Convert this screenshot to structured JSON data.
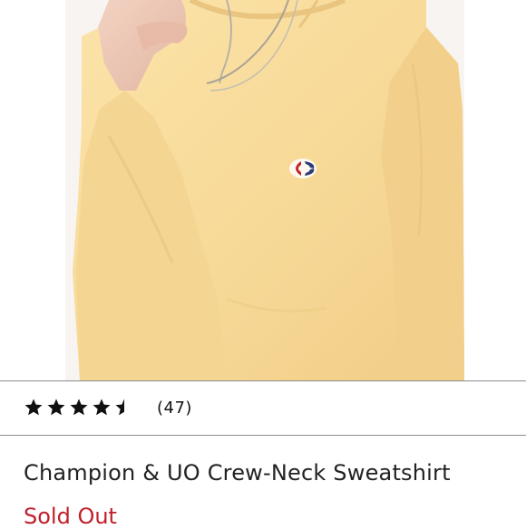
{
  "product": {
    "image_alt": "Champion & UO Crew-Neck Sweatshirt",
    "title": "Champion & UO Crew-Neck Sweatshirt",
    "status": "Sold Out",
    "garment_color": "#f8dc9e",
    "status_color": "#c0202b"
  },
  "rating": {
    "value": 4.5,
    "max": 5,
    "count_label": "(47)"
  }
}
